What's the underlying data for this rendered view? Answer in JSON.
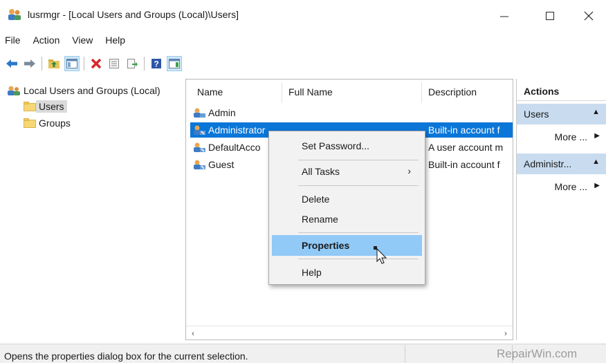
{
  "window": {
    "title": "lusrmgr - [Local Users and Groups (Local)\\Users]",
    "app_icon": "users-management-icon",
    "controls": {
      "minimize": "—",
      "maximize": "☐",
      "close": "✕"
    }
  },
  "menu": [
    "File",
    "Action",
    "View",
    "Help"
  ],
  "toolbar": {
    "icons": [
      "back-arrow-icon",
      "forward-arrow-icon",
      "up-folder-icon",
      "show-hide-tree-icon",
      "delete-icon",
      "properties-icon",
      "export-list-icon",
      "help-icon",
      "action-pane-icon"
    ]
  },
  "tree": {
    "root": "Local Users and Groups (Local)",
    "children": [
      "Users",
      "Groups"
    ],
    "selected": "Users"
  },
  "list": {
    "columns": [
      "Name",
      "Full Name",
      "Description"
    ],
    "rows": [
      {
        "name": "Admin",
        "full_name": "",
        "description": ""
      },
      {
        "name": "Administrator",
        "full_name": "",
        "description": "Built-in account f"
      },
      {
        "name": "DefaultAcco",
        "full_name": "",
        "description": "A user account m"
      },
      {
        "name": "Guest",
        "full_name": "",
        "description": "Built-in account f"
      }
    ],
    "selected_index": 1
  },
  "actions": {
    "title": "Actions",
    "groups": [
      {
        "label": "Users",
        "more": "More ..."
      },
      {
        "label": "Administr...",
        "more": "More ..."
      }
    ]
  },
  "context_menu": {
    "items": [
      "Set Password...",
      "All Tasks",
      "Delete",
      "Rename",
      "Properties",
      "Help"
    ],
    "highlighted": "Properties"
  },
  "status": {
    "text": "Opens the properties dialog box for the current selection.",
    "watermark": "RepairWin.com"
  },
  "colors": {
    "selection": "#0a76d8",
    "menu_highlight": "#91c9f7",
    "actions_group": "#c9dcef"
  }
}
